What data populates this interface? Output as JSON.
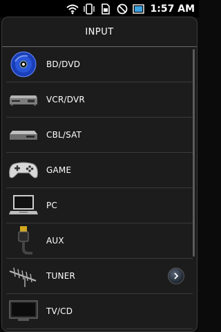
{
  "status_bar": {
    "time": "1:57 AM",
    "icons": [
      "wifi-icon",
      "vibrate-icon",
      "sim-icon",
      "no-sync-icon",
      "battery-icon"
    ]
  },
  "panel": {
    "title": "INPUT",
    "items": [
      {
        "label": "BD/DVD",
        "icon": "disc-icon"
      },
      {
        "label": "VCR/DVR",
        "icon": "vcr-icon"
      },
      {
        "label": "CBL/SAT",
        "icon": "settop-box-icon"
      },
      {
        "label": "GAME",
        "icon": "gamepad-icon"
      },
      {
        "label": "PC",
        "icon": "laptop-icon"
      },
      {
        "label": "AUX",
        "icon": "hdmi-cable-icon"
      },
      {
        "label": "TUNER",
        "icon": "antenna-icon",
        "has_arrow": true
      },
      {
        "label": "TV/CD",
        "icon": "tv-icon"
      }
    ]
  },
  "colors": {
    "background": "#0b0b0b",
    "panel": "#1c1c1c",
    "disc_accent": "#2a56d8"
  }
}
